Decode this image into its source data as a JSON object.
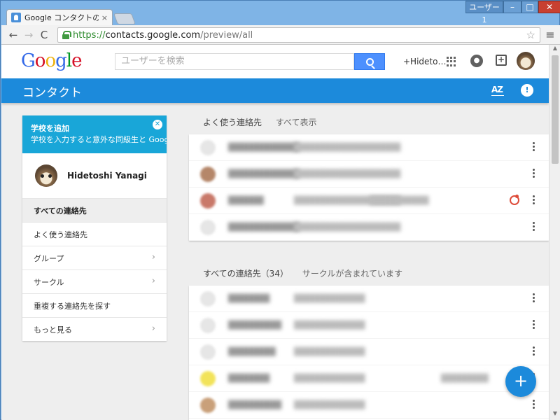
{
  "browser": {
    "tab_title": "Google コンタクトのプレビュー",
    "tab_close": "×",
    "user_badge": "ユーザー 1",
    "window_buttons": {
      "minimize": "–",
      "maximize": "□",
      "close": "✕"
    },
    "nav": {
      "back": "←",
      "forward": "→",
      "reload": "C"
    },
    "url": {
      "scheme": "https://",
      "host": "contacts.google.com",
      "path": "/preview/all"
    },
    "star": "☆",
    "menu": "≡"
  },
  "gbar": {
    "logo": {
      "letters": [
        "G",
        "o",
        "o",
        "g",
        "l",
        "e"
      ],
      "colors": [
        "#3369e8",
        "#d50f25",
        "#eeb211",
        "#3369e8",
        "#009925",
        "#d50f25"
      ]
    },
    "search_placeholder": "ユーザーを検索",
    "user_link": "+Hideto…",
    "notif_glyph": "●",
    "share_glyph": "+"
  },
  "appbar": {
    "title": "コンタクト",
    "sort_label": "AZ",
    "feedback_glyph": "!"
  },
  "sidebar": {
    "promo": {
      "title": "学校を追加",
      "text": "学校を入力すると意外な同級生と Google+ で会えるかも",
      "close_glyph": "✕"
    },
    "profile_name": "Hidetoshi Yanagi",
    "items": [
      {
        "label": "すべての連絡先",
        "chevron": ""
      },
      {
        "label": "よく使う連絡先",
        "chevron": ""
      },
      {
        "label": "グループ",
        "chevron": "›"
      },
      {
        "label": "サークル",
        "chevron": "›"
      },
      {
        "label": "重複する連絡先を探す",
        "chevron": ""
      },
      {
        "label": "もっと見る",
        "chevron": "›"
      }
    ]
  },
  "frequent": {
    "heading": "よく使う連絡先",
    "link": "すべて表示"
  },
  "all": {
    "heading": "すべての連絡先（34）",
    "link": "サークルが含まれています"
  },
  "fab_glyph": "+"
}
